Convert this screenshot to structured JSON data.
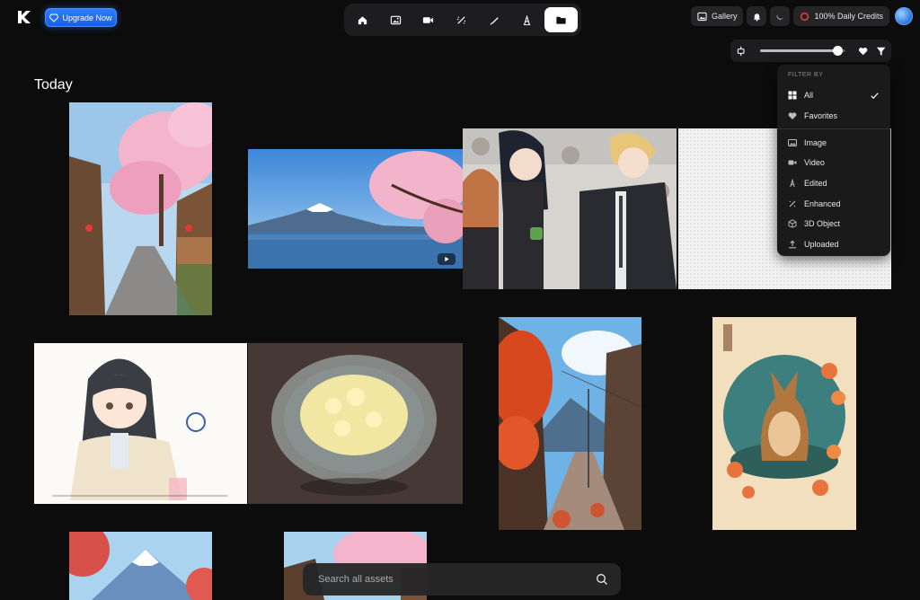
{
  "header": {
    "upgrade_label": "Upgrade Now",
    "nav": [
      {
        "icon": "home-icon"
      },
      {
        "icon": "image-icon"
      },
      {
        "icon": "video-icon"
      },
      {
        "icon": "enhance-icon"
      },
      {
        "icon": "edit-brush-icon"
      },
      {
        "icon": "text-edit-icon"
      },
      {
        "icon": "folder-icon",
        "active": true
      }
    ],
    "gallery_label": "Gallery",
    "credits_label": "100% Daily Credits"
  },
  "toolbar": {
    "size_slider_value": 0.9
  },
  "filter_menu": {
    "heading": "FILTER BY",
    "items": [
      {
        "label": "All",
        "icon": "grid-icon",
        "selected": true
      },
      {
        "label": "Favorites",
        "icon": "heart-icon"
      },
      {
        "label": "Image",
        "icon": "image-icon"
      },
      {
        "label": "Video",
        "icon": "video-icon"
      },
      {
        "label": "Edited",
        "icon": "text-edit-icon"
      },
      {
        "label": "Enhanced",
        "icon": "enhance-icon"
      },
      {
        "label": "3D Object",
        "icon": "cube-icon"
      },
      {
        "label": "Uploaded",
        "icon": "upload-icon"
      }
    ]
  },
  "gallery": {
    "section_title": "Today"
  },
  "search": {
    "placeholder": "Search all assets"
  },
  "colors": {
    "background": "#0c0c0c",
    "accent": "#1a6cff",
    "panel": "#1d1d1f",
    "credits_ring": "#e53935"
  }
}
